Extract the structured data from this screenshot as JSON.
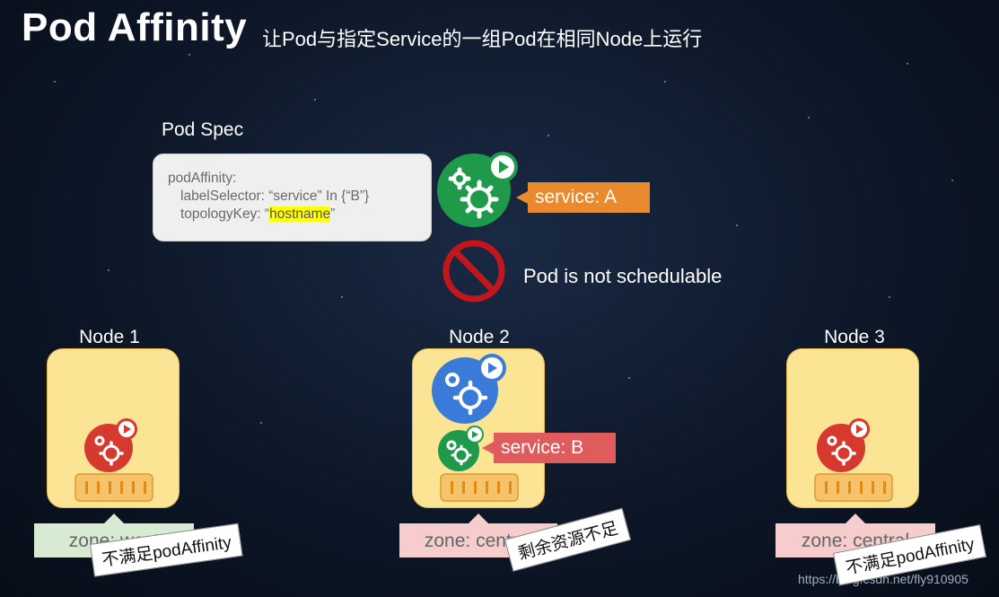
{
  "header": {
    "title": "Pod Affinity",
    "subtitle": "让Pod与指定Service的一组Pod在相同Node上运行"
  },
  "pod_spec": {
    "label": "Pod Spec",
    "line1": "podAffinity:",
    "line2": "labelSelector: “service” In {“B”}",
    "line3_prefix": "topologyKey: “",
    "line3_highlight": "hostname",
    "line3_suffix": "”"
  },
  "incoming_pod": {
    "icon": "green-gear-pod-icon",
    "service_tag": "service: A"
  },
  "status": {
    "icon": "prohibited-icon",
    "text": "Pod is not schedulable"
  },
  "nodes": [
    {
      "label": "Node 1",
      "zone": "zone: west",
      "note": "不满足podAffinity"
    },
    {
      "label": "Node 2",
      "zone": "zone: central",
      "note": "剩余资源不足",
      "service_tag": "service: B"
    },
    {
      "label": "Node 3",
      "zone": "zone: central",
      "note": "不满足podAffinity"
    }
  ],
  "watermark": "https://blog.csdn.net/fly910905",
  "colors": {
    "pod_green": "#1e9a4a",
    "pod_red": "#d63a2f",
    "pod_blue": "#3a7ad8",
    "service_a": "#e98a2e",
    "service_b": "#e05c5c",
    "node_fill": "#fbe594",
    "zone_west": "#d6ebd1",
    "zone_central": "#f6cccc",
    "prohibited": "#c0161c",
    "highlight": "#ffff00"
  }
}
